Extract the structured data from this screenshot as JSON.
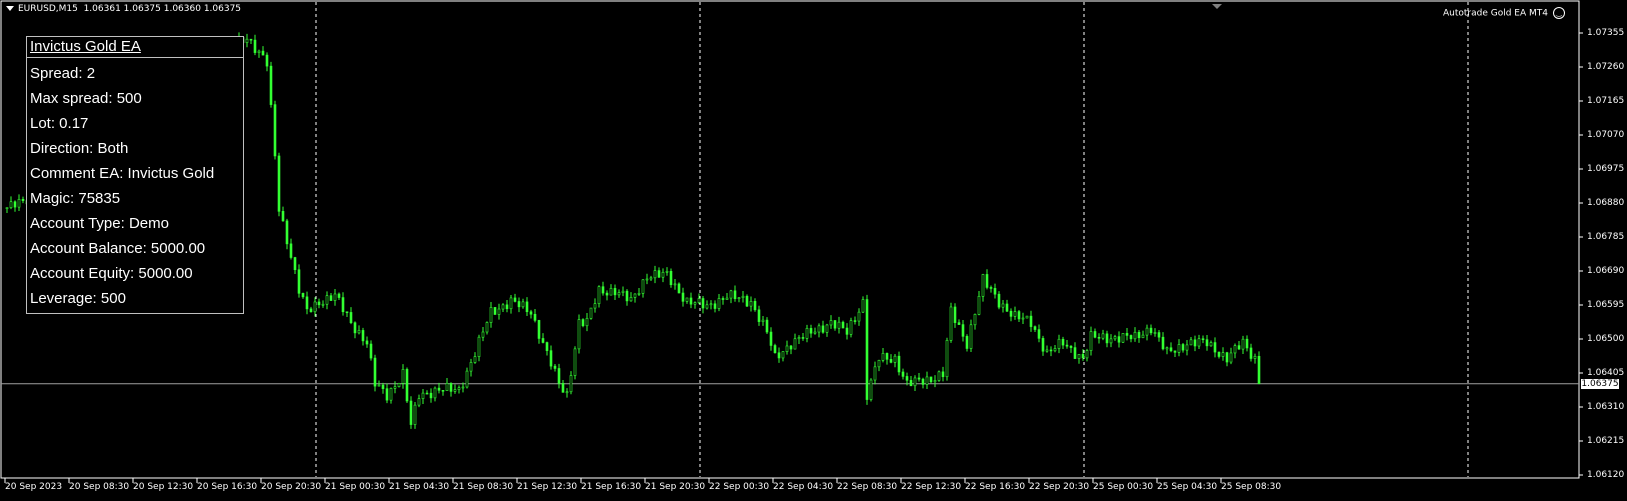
{
  "header": {
    "symbol": "EURUSD,M15",
    "ohlc": "1.06361 1.06375 1.06360 1.06375"
  },
  "ea_label": "Autotrade Gold EA MT4",
  "ea_icon": "smiley-icon",
  "panel": {
    "title": "Invictus Gold EA",
    "rows": [
      "Spread: 2",
      "Max spread: 500",
      "Lot: 0.17",
      "Direction: Both",
      "Comment EA: Invictus Gold",
      "Magic: 75835",
      "Account Type: Demo",
      "Account Balance: 5000.00",
      "Account Equity: 5000.00",
      "Leverage: 500"
    ]
  },
  "colors": {
    "background": "#000000",
    "candle": "#33ff33",
    "grid_separator": "#ffffff",
    "bid_line": "#a0a0a0"
  },
  "chart_data": {
    "type": "candlestick",
    "timeframe": "M15",
    "ylim": [
      1.061,
      1.0745
    ],
    "y_ticks": [
      "1.07355",
      "1.07260",
      "1.07165",
      "1.07070",
      "1.06975",
      "1.06880",
      "1.06785",
      "1.06690",
      "1.06595",
      "1.06500",
      "1.06405",
      "1.06310",
      "1.06215",
      "1.06120"
    ],
    "current_price": "1.06375",
    "x_ticks": [
      "20 Sep 2023",
      "20 Sep 08:30",
      "20 Sep 12:30",
      "20 Sep 16:30",
      "20 Sep 20:30",
      "21 Sep 00:30",
      "21 Sep 04:30",
      "21 Sep 08:30",
      "21 Sep 12:30",
      "21 Sep 16:30",
      "21 Sep 20:30",
      "22 Sep 00:30",
      "22 Sep 04:30",
      "22 Sep 08:30",
      "22 Sep 12:30",
      "22 Sep 16:30",
      "22 Sep 20:30",
      "25 Sep 00:30",
      "25 Sep 04:30",
      "25 Sep 08:30"
    ],
    "day_separators_bar": [
      78,
      174,
      270,
      366
    ],
    "close_keypoints": [
      [
        0,
        1.06867
      ],
      [
        4,
        1.06882
      ],
      [
        60,
        1.07346
      ],
      [
        65,
        1.07268
      ],
      [
        67,
        1.07012
      ],
      [
        68,
        1.06867
      ],
      [
        70,
        1.0678
      ],
      [
        73,
        1.06635
      ],
      [
        75,
        1.06576
      ],
      [
        78,
        1.06605
      ],
      [
        82,
        1.0662
      ],
      [
        86,
        1.06547
      ],
      [
        90,
        1.06489
      ],
      [
        92,
        1.06373
      ],
      [
        95,
        1.06344
      ],
      [
        99,
        1.06402
      ],
      [
        101,
        1.06257
      ],
      [
        103,
        1.06344
      ],
      [
        108,
        1.06358
      ],
      [
        113,
        1.06358
      ],
      [
        117,
        1.0646
      ],
      [
        121,
        1.06576
      ],
      [
        126,
        1.06605
      ],
      [
        131,
        1.06576
      ],
      [
        134,
        1.06489
      ],
      [
        138,
        1.06373
      ],
      [
        140,
        1.06344
      ],
      [
        143,
        1.06547
      ],
      [
        145,
        1.06547
      ],
      [
        148,
        1.06635
      ],
      [
        152,
        1.06635
      ],
      [
        156,
        1.06605
      ],
      [
        160,
        1.06678
      ],
      [
        165,
        1.06678
      ],
      [
        170,
        1.06605
      ],
      [
        175,
        1.06591
      ],
      [
        180,
        1.0662
      ],
      [
        186,
        1.06605
      ],
      [
        190,
        1.06518
      ],
      [
        192,
        1.06446
      ],
      [
        196,
        1.06489
      ],
      [
        201,
        1.06518
      ],
      [
        206,
        1.06547
      ],
      [
        210,
        1.06518
      ],
      [
        214,
        1.06605
      ],
      [
        215,
        1.06344
      ],
      [
        218,
        1.06446
      ],
      [
        222,
        1.06446
      ],
      [
        225,
        1.06373
      ],
      [
        230,
        1.06387
      ],
      [
        234,
        1.06402
      ],
      [
        236,
        1.06576
      ],
      [
        240,
        1.06489
      ],
      [
        244,
        1.06664
      ],
      [
        248,
        1.06605
      ],
      [
        252,
        1.06562
      ],
      [
        256,
        1.06547
      ],
      [
        260,
        1.0646
      ],
      [
        264,
        1.06489
      ],
      [
        269,
        1.06446
      ],
      [
        271,
        1.06504
      ],
      [
        277,
        1.06504
      ],
      [
        282,
        1.06504
      ],
      [
        286,
        1.06533
      ],
      [
        290,
        1.0646
      ],
      [
        295,
        1.06489
      ],
      [
        300,
        1.06489
      ],
      [
        305,
        1.06446
      ],
      [
        309,
        1.06489
      ],
      [
        312,
        1.06446
      ],
      [
        313,
        1.06375
      ]
    ]
  }
}
